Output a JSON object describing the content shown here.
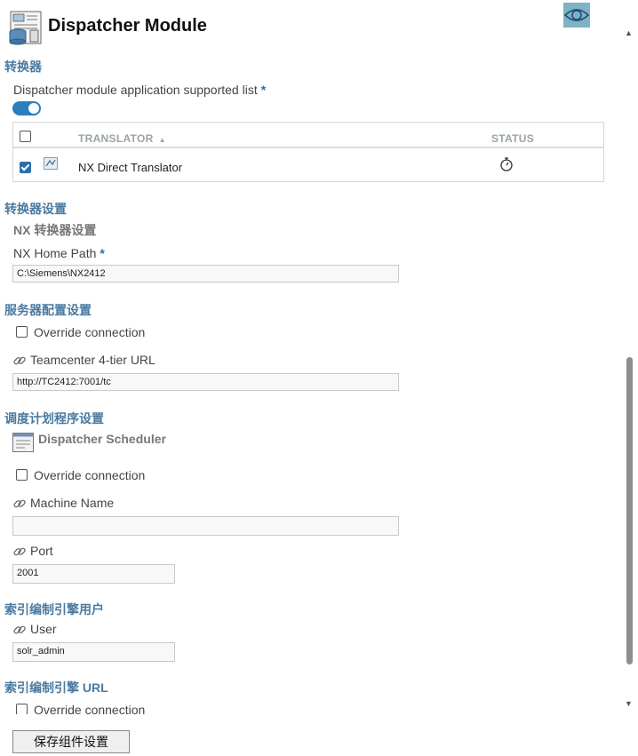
{
  "header": {
    "title": "Dispatcher Module"
  },
  "translators_section": {
    "title": "转换器",
    "supported_list_label": "Dispatcher module application supported list",
    "required_mark": "*",
    "table": {
      "col_translator": "TRANSLATOR",
      "col_status": "STATUS",
      "rows": [
        {
          "name": "NX Direct Translator",
          "checked": true
        }
      ]
    }
  },
  "translator_settings": {
    "title": "转换器设置",
    "nx_subtitle": "NX 转换器设置",
    "nx_home_label": "NX Home Path",
    "required_mark": "*",
    "nx_home_value": "C:\\Siemens\\NX2412"
  },
  "server_config": {
    "title": "服务器配置设置",
    "override_label": "Override connection",
    "tc_url_label": "Teamcenter 4-tier URL",
    "tc_url_value": "http://TC2412:7001/tc"
  },
  "scheduler_settings": {
    "title": "调度计划程序设置",
    "scheduler_label": "Dispatcher Scheduler",
    "override_label": "Override connection",
    "machine_name_label": "Machine Name",
    "machine_name_value": "",
    "port_label": "Port",
    "port_value": "2001"
  },
  "index_user": {
    "title": "索引编制引擎用户",
    "user_label": "User",
    "user_value": "solr_admin"
  },
  "index_url": {
    "title": "索引编制引擎 URL",
    "override_label": "Override connection"
  },
  "footer": {
    "save_label": "保存组件设置"
  },
  "colors": {
    "accent": "#2a7fbf",
    "section_title": "#4a7aa0",
    "eye_bg": "#7fb2c8"
  }
}
